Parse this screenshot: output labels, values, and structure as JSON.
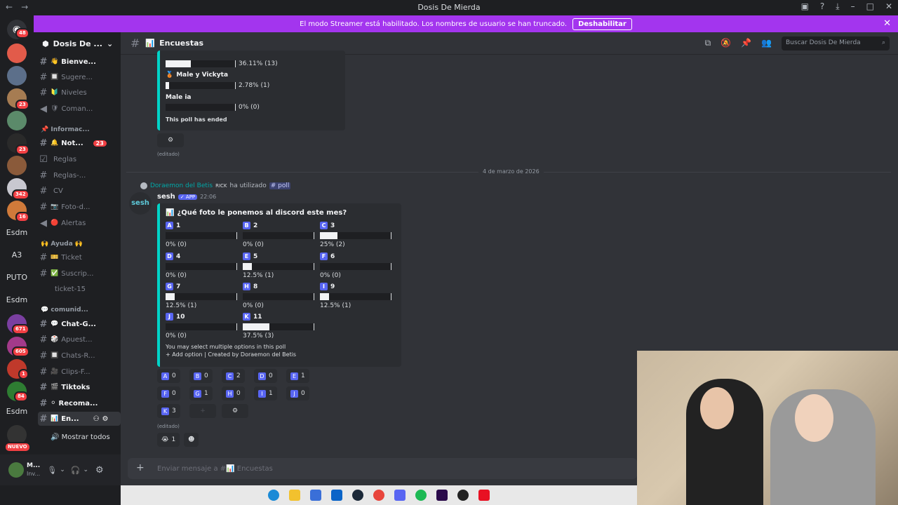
{
  "window": {
    "title": "Dosis De Mierda"
  },
  "banner": {
    "text": "El modo Streamer está habilitado. Los nombres de usuario se han truncado.",
    "button": "Deshabilitar"
  },
  "server": {
    "name": "Dosis De ..."
  },
  "servers": [
    {
      "badge": "48"
    },
    {
      "badge": ""
    },
    {
      "badge": ""
    },
    {
      "badge": "23"
    },
    {
      "badge": ""
    },
    {
      "badge": "23"
    },
    {
      "badge": ""
    },
    {
      "badge": "342"
    },
    {
      "badge": "16"
    }
  ],
  "server_texts": [
    "Esdm",
    "A3",
    "PUTO",
    "Esdm",
    "Esdm"
  ],
  "server_badges_lower": [
    "671",
    "605",
    "1",
    "84"
  ],
  "new_badge": "NUEVO",
  "channels": [
    {
      "label": "Bienve...",
      "emoji": "👋",
      "bold": true
    },
    {
      "label": "Sugere...",
      "emoji": "🔲",
      "bold": false
    },
    {
      "label": "Niveles",
      "emoji": "🔰",
      "bold": false
    },
    {
      "label": "Coman...",
      "emoji": "🛡",
      "bold": false
    },
    {
      "label": "Not...",
      "emoji": "🔔",
      "bold": true,
      "badge": "23"
    },
    {
      "label": "Reglas",
      "emoji": "",
      "bold": false
    },
    {
      "label": "Reglas-...",
      "emoji": "",
      "bold": false
    },
    {
      "label": "CV",
      "emoji": "",
      "bold": false
    },
    {
      "label": "Foto-d...",
      "emoji": "📷",
      "bold": false
    },
    {
      "label": "Alertas",
      "emoji": "🔴",
      "bold": false
    },
    {
      "label": "Ticket",
      "emoji": "🎫",
      "bold": false
    },
    {
      "label": "Suscrip...",
      "emoji": "✅",
      "bold": false
    },
    {
      "label": "ticket-15",
      "emoji": "",
      "bold": false
    },
    {
      "label": "Chat-G...",
      "emoji": "💬",
      "bold": true
    },
    {
      "label": "Apuest...",
      "emoji": "🎲",
      "bold": false
    },
    {
      "label": "Chats-R...",
      "emoji": "🔲",
      "bold": false
    },
    {
      "label": "Clips-F...",
      "emoji": "🎥",
      "bold": false
    },
    {
      "label": "Tiktoks",
      "emoji": "🎬",
      "bold": true
    },
    {
      "label": "Recoma...",
      "emoji": "⚪",
      "bold": true
    },
    {
      "label": "En...",
      "emoji": "📊",
      "bold": true
    }
  ],
  "categories": [
    "📌 Informac...",
    "🙌 Ayuda 🙌",
    "💬 comunid..."
  ],
  "show_all": "Mostrar todos",
  "user": {
    "name": "M...",
    "status": "Inv..."
  },
  "channel_header": {
    "title": "Encuestas",
    "search": "Buscar Dosis De Mierda"
  },
  "prev_poll": {
    "opt_a_stat": "36.11% (13)",
    "opt_b_label": "Male y Vickyta",
    "opt_b_stat": "2.78% (1)",
    "opt_c_label": "Male ia",
    "opt_c_stat": "0% (0)",
    "ended": "This poll has ended",
    "edited": "(editado)"
  },
  "date_divider": "4 de marzo de 2026",
  "reply": {
    "user": "Doraemon del Betis",
    "tag": "RICK",
    "action": "ha utilizado",
    "command": "poll"
  },
  "message": {
    "author": "sesh",
    "app": "APP",
    "time": "22:06",
    "avatar_text": "sesh",
    "edited": "(editado)"
  },
  "poll": {
    "question": "¿Qué foto le ponemos al discord este mes?",
    "options": [
      {
        "letter": "A",
        "label": "1",
        "stat": "0% (0)",
        "pct": 0
      },
      {
        "letter": "B",
        "label": "2",
        "stat": "0% (0)",
        "pct": 0
      },
      {
        "letter": "C",
        "label": "3",
        "stat": "25% (2)",
        "pct": 25
      },
      {
        "letter": "D",
        "label": "4",
        "stat": "0% (0)",
        "pct": 0
      },
      {
        "letter": "E",
        "label": "5",
        "stat": "12.5% (1)",
        "pct": 12.5
      },
      {
        "letter": "F",
        "label": "6",
        "stat": "0% (0)",
        "pct": 0
      },
      {
        "letter": "G",
        "label": "7",
        "stat": "12.5% (1)",
        "pct": 12.5
      },
      {
        "letter": "H",
        "label": "8",
        "stat": "0% (0)",
        "pct": 0
      },
      {
        "letter": "I",
        "label": "9",
        "stat": "12.5% (1)",
        "pct": 12.5
      },
      {
        "letter": "J",
        "label": "10",
        "stat": "0% (0)",
        "pct": 0
      },
      {
        "letter": "K",
        "label": "11",
        "stat": "37.5% (3)",
        "pct": 37.5
      }
    ],
    "footer": "You may select multiple options in this poll",
    "add_option": "Add option | Created by Doraemon del Betis"
  },
  "buttons": [
    {
      "letter": "A",
      "count": "0"
    },
    {
      "letter": "B",
      "count": "0"
    },
    {
      "letter": "C",
      "count": "2"
    },
    {
      "letter": "D",
      "count": "0"
    },
    {
      "letter": "E",
      "count": "1"
    },
    {
      "letter": "F",
      "count": "0"
    },
    {
      "letter": "G",
      "count": "1"
    },
    {
      "letter": "H",
      "count": "0"
    },
    {
      "letter": "I",
      "count": "1"
    },
    {
      "letter": "J",
      "count": "0"
    },
    {
      "letter": "K",
      "count": "3"
    }
  ],
  "reaction": {
    "emoji": "😭",
    "count": "1"
  },
  "composer": {
    "placeholder": "Enviar mensaje a #📊 Encuestas"
  }
}
